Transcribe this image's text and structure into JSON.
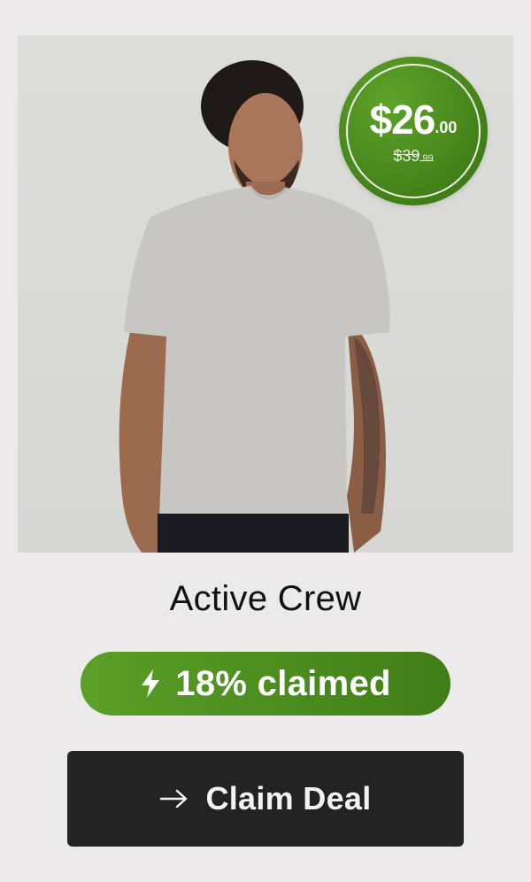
{
  "product": {
    "image_alt": "Model wearing a light grey crew neck tee",
    "name": "Active Crew"
  },
  "price": {
    "current_whole": "$26",
    "current_cents": ".00",
    "original_whole": "$39",
    "original_cents": ".99"
  },
  "claimed": {
    "icon": "lightning-bolt-icon",
    "label": "18% claimed"
  },
  "cta": {
    "icon": "arrow-right-icon",
    "label": "Claim Deal"
  },
  "colors": {
    "background": "#ebe9e9",
    "accent_green": "#4a8d1f",
    "button_dark": "#232323"
  }
}
